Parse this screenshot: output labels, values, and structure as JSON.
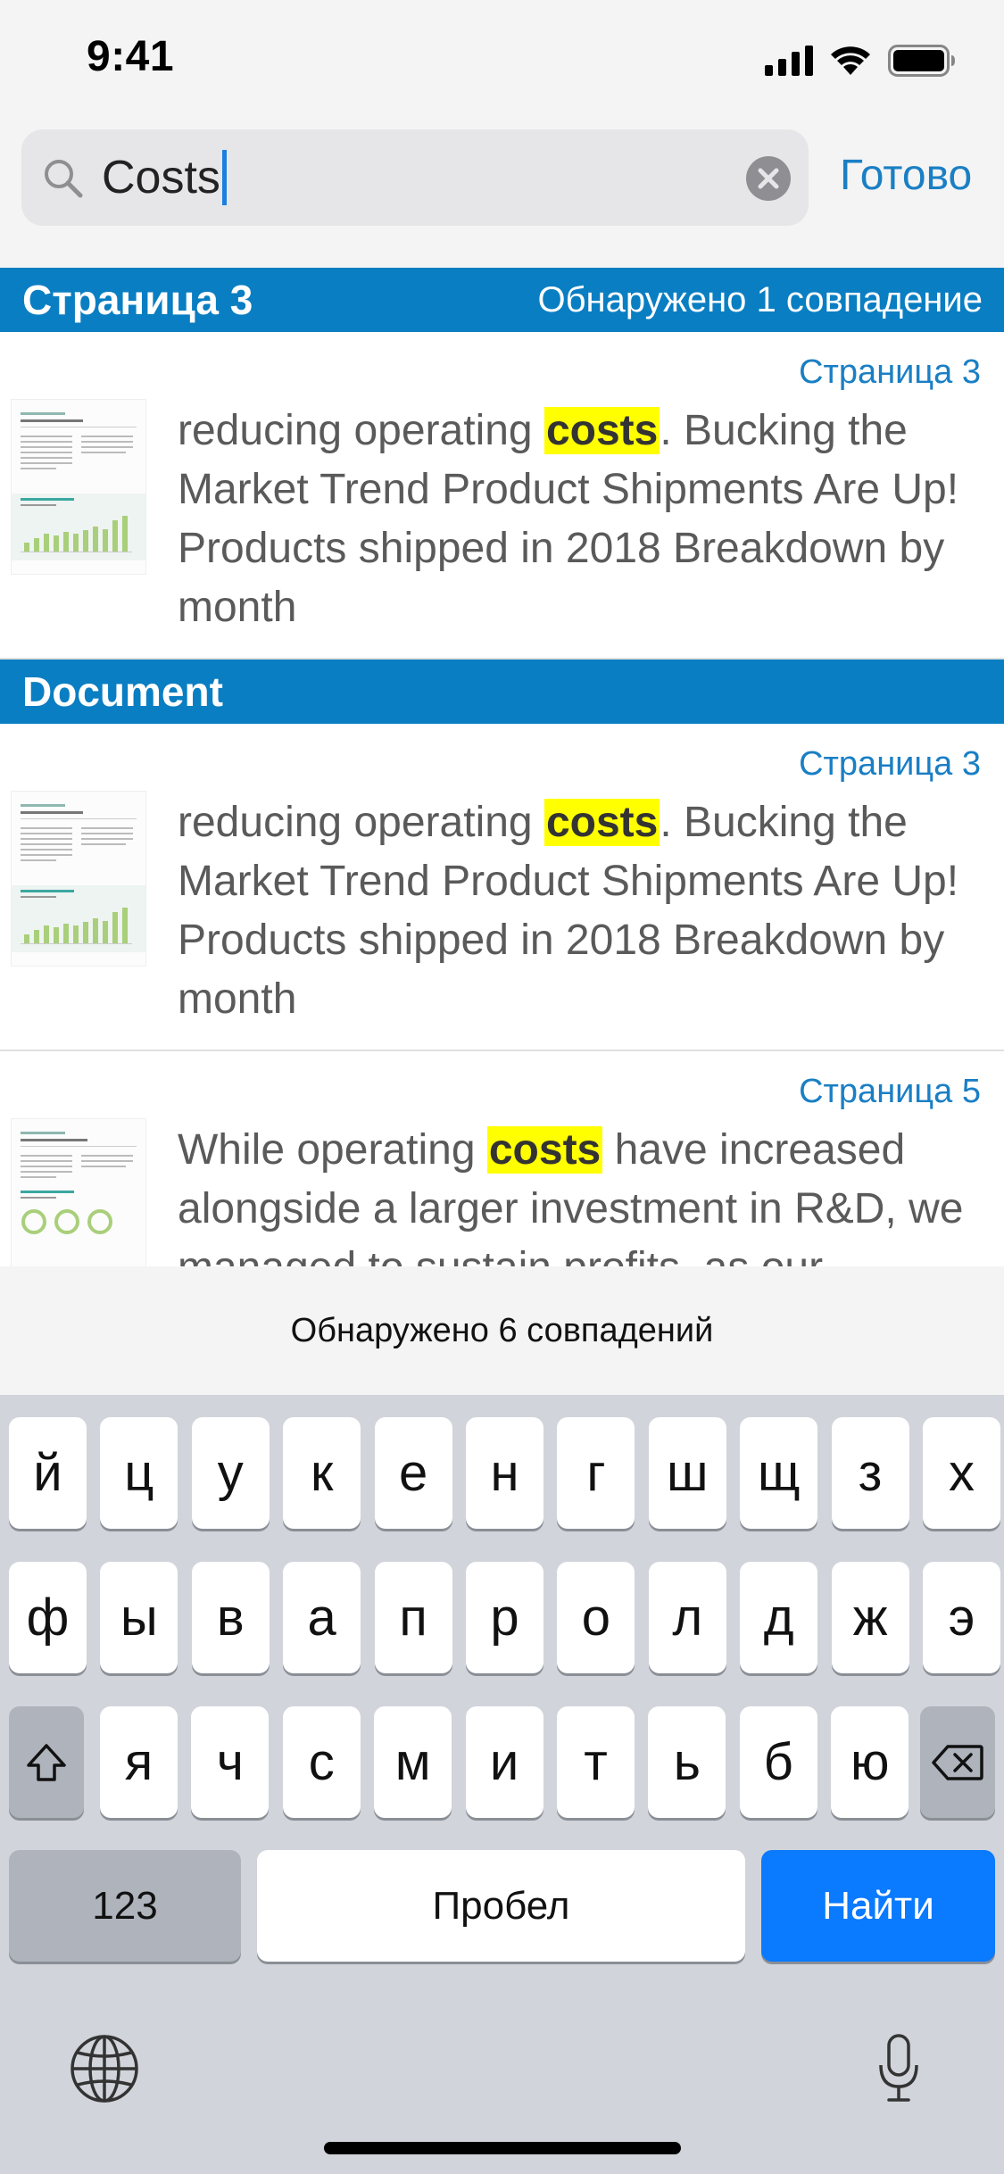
{
  "status_bar": {
    "time": "9:41"
  },
  "search": {
    "query": "Costs",
    "done_label": "Готово"
  },
  "sections": [
    {
      "title": "Страница 3",
      "count": "Обнаружено 1 совпадение",
      "results": [
        {
          "page": "Страница 3",
          "before": "reducing operating ",
          "match": "costs",
          "after": ". Bucking the Market Trend Product Shipments Are Up! Products shipped in 2018 Breakdown by month"
        }
      ]
    },
    {
      "title": "Document",
      "count": "",
      "results": [
        {
          "page": "Страница 3",
          "before": "reducing operating ",
          "match": "costs",
          "after": ". Bucking the Market Trend Product Shipments Are Up! Products shipped in 2018 Breakdown by month"
        },
        {
          "page": "Страница 5",
          "before": "While operating ",
          "match": "costs",
          "after": " have increased alongside a larger investment in R&D, we managed to sustain profits, as our"
        }
      ]
    }
  ],
  "match_summary": "Обнаружено 6 совпадений",
  "keyboard": {
    "row1": [
      "й",
      "ц",
      "у",
      "к",
      "е",
      "н",
      "г",
      "ш",
      "щ",
      "з",
      "х"
    ],
    "row2": [
      "ф",
      "ы",
      "в",
      "а",
      "п",
      "р",
      "о",
      "л",
      "д",
      "ж",
      "э"
    ],
    "row3": [
      "я",
      "ч",
      "с",
      "м",
      "и",
      "т",
      "ь",
      "б",
      "ю"
    ],
    "numbers_label": "123",
    "space_label": "Пробел",
    "search_label": "Найти",
    "shift_icon": "shift-icon",
    "delete_icon": "delete-icon",
    "globe_icon": "globe-icon",
    "mic_icon": "microphone-icon"
  },
  "colors": {
    "section_header": "#0a7ec2",
    "accent": "#1a7fc4",
    "highlight": "#ffff00",
    "search_key": "#0a7aff"
  }
}
